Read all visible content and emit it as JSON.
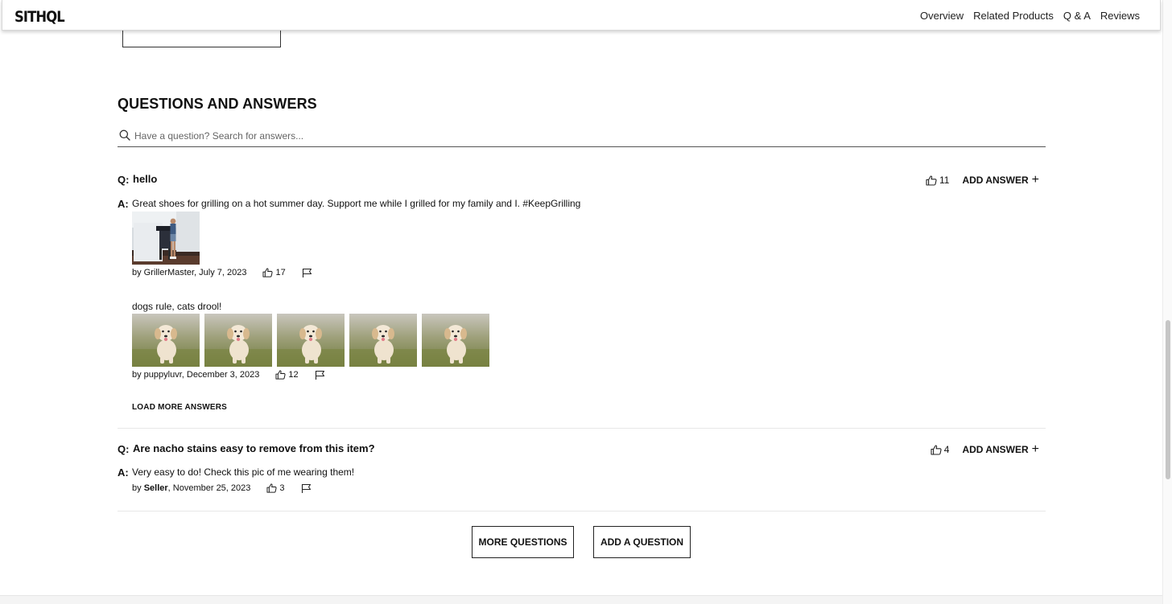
{
  "header": {
    "logo": "SITHQL",
    "nav": [
      "Overview",
      "Related Products",
      "Q & A",
      "Reviews"
    ]
  },
  "qa": {
    "title": "QUESTIONS AND ANSWERS",
    "search_placeholder": "Have a question? Search for answers...",
    "q_prefix": "Q:",
    "a_prefix": "A:",
    "add_answer_label": "ADD ANSWER",
    "load_more_label": "LOAD MORE ANSWERS",
    "questions": [
      {
        "text": "hello",
        "helpful": "11",
        "answers": [
          {
            "text": "Great shoes for grilling on a hot summer day. Support me while I grilled for my family and I. #KeepGrilling",
            "by": "by GrillerMaster, July 7, 2023",
            "helpful": "17",
            "photos": [
              "griller-photo"
            ]
          },
          {
            "text": "dogs rule, cats drool!",
            "by": "by puppyluvr, December 3, 2023",
            "helpful": "12",
            "photos": [
              "puppy-photo",
              "puppy-photo",
              "puppy-photo",
              "puppy-photo",
              "puppy-photo"
            ]
          }
        ]
      },
      {
        "text": "Are nacho stains easy to remove from this item?",
        "helpful": "4",
        "answers": [
          {
            "text": "Very easy to do! Check this pic of me wearing them!",
            "by_prefix": "by ",
            "by_name": "Seller",
            "by_suffix": ", November 25, 2023",
            "helpful": "3",
            "photos": []
          }
        ]
      }
    ],
    "more_questions_label": "MORE QUESTIONS",
    "add_question_label": "ADD A QUESTION"
  },
  "icons": {
    "search": "search-icon",
    "helpful": "thumbs-up-icon",
    "report": "flag-icon",
    "add": "plus-icon"
  }
}
